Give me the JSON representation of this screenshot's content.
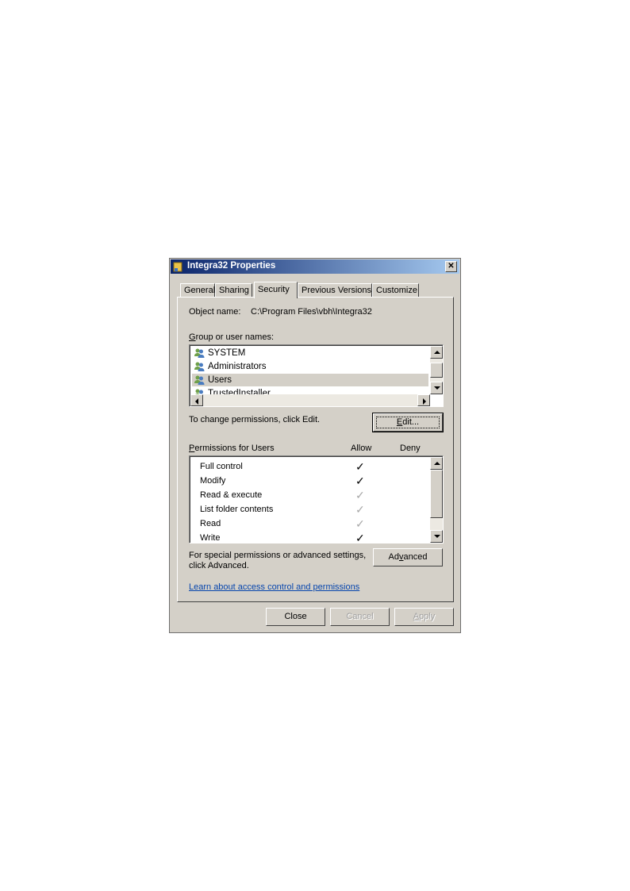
{
  "window": {
    "title": "Integra32 Properties",
    "close_glyph": "✕"
  },
  "tabs": [
    {
      "label": "General"
    },
    {
      "label": "Sharing"
    },
    {
      "label": "Security",
      "active": true
    },
    {
      "label": "Previous Versions"
    },
    {
      "label": "Customize"
    }
  ],
  "object": {
    "label": "Object name:",
    "value": "C:\\Program Files\\vbh\\Integra32"
  },
  "groups": {
    "label_prefix": "G",
    "label_rest": "roup or user names:",
    "items": [
      {
        "name": "SYSTEM",
        "icon": "users-icon"
      },
      {
        "name": "Administrators",
        "icon": "users-icon"
      },
      {
        "name": "Users",
        "icon": "users-icon",
        "selected": true
      },
      {
        "name": "TrustedInstaller",
        "icon": "users-icon"
      }
    ]
  },
  "change_hint": "To change permissions, click Edit.",
  "edit_button": {
    "prefix": "E",
    "rest": "dit..."
  },
  "permissions": {
    "label_prefix": "P",
    "label_rest": "ermissions for Users",
    "allow_header": "Allow",
    "deny_header": "Deny",
    "check_glyph": "✓",
    "rows": [
      {
        "name": "Full control",
        "allow": "granted"
      },
      {
        "name": "Modify",
        "allow": "granted"
      },
      {
        "name": "Read & execute",
        "allow": "inherited"
      },
      {
        "name": "List folder contents",
        "allow": "inherited"
      },
      {
        "name": "Read",
        "allow": "inherited"
      },
      {
        "name": "Write",
        "allow": "granted"
      }
    ]
  },
  "special": {
    "line1": "For special permissions or advanced settings,",
    "line2": "click Advanced."
  },
  "advanced_button": {
    "prefix": "Ad",
    "underlined": "v",
    "rest": "anced"
  },
  "learn_link": "Learn about access control and permissions",
  "footer": {
    "close": "Close",
    "cancel": "Cancel",
    "apply_prefix": "A",
    "apply_rest": "pply"
  },
  "colors": {
    "title_start": "#0a246a",
    "title_end": "#a6caf0",
    "dialog_bg": "#d4d0c8",
    "link": "#0645ad"
  }
}
